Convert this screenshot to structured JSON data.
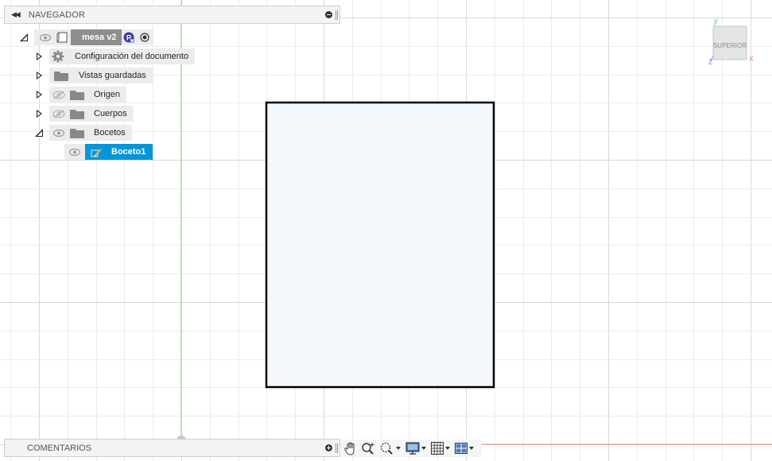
{
  "navigator": {
    "title": "NAVEGADOR",
    "root": {
      "label": "mesa v2"
    },
    "items": [
      {
        "label": "Configuración del documento",
        "expanded": false
      },
      {
        "label": "Vistas guardadas",
        "expanded": false
      },
      {
        "label": "Origen",
        "expanded": false,
        "hidden": true
      },
      {
        "label": "Cuerpos",
        "expanded": false,
        "hidden": true
      },
      {
        "label": "Bocetos",
        "expanded": true
      },
      {
        "label": "Boceto1",
        "selected": true
      }
    ]
  },
  "viewcube": {
    "face_label": "SUPERIOR",
    "axes": {
      "x": "X",
      "y": "Y",
      "z": "Z"
    }
  },
  "comments": {
    "title": "COMENTARIOS"
  },
  "navbar": {
    "tools": [
      "pan-tool",
      "zoom-tool",
      "zoom-window-tool",
      "display-settings",
      "grid-settings",
      "viewports"
    ]
  },
  "colors": {
    "selection": "#0696d7",
    "sketch_fill": "#f2f8fc",
    "grid_minor": "#ececec",
    "grid_major": "#d8d8d8",
    "axis_green": "#7bdc7b",
    "axis_red": "#f08080"
  }
}
